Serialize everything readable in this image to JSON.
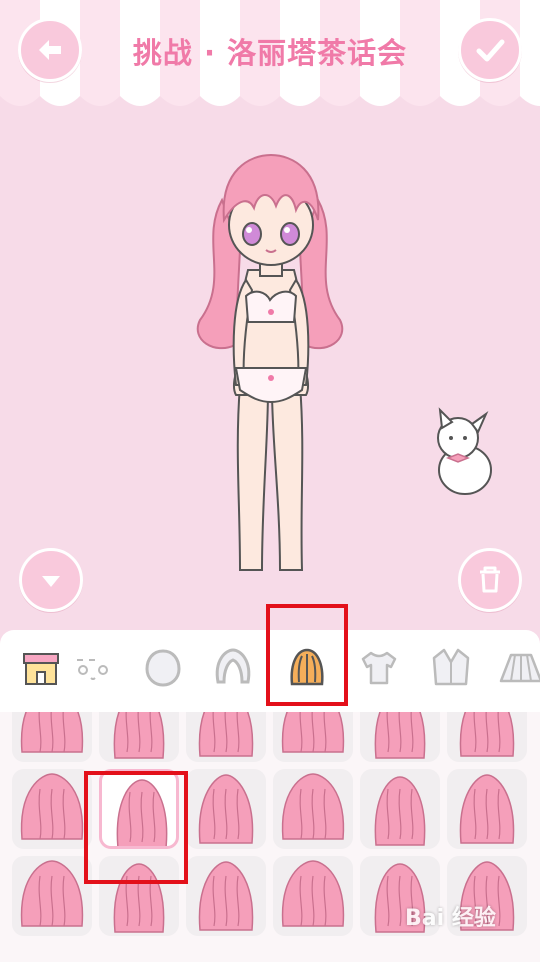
{
  "header": {
    "title": "挑战 · 洛丽塔茶话会"
  },
  "tabs": [
    {
      "id": "shop",
      "icon": "shop-icon"
    },
    {
      "id": "face",
      "icon": "face-icon"
    },
    {
      "id": "head",
      "icon": "head-icon"
    },
    {
      "id": "bangs",
      "icon": "bangs-icon"
    },
    {
      "id": "back-hair",
      "icon": "back-hair-icon",
      "selected": true
    },
    {
      "id": "top",
      "icon": "tshirt-icon"
    },
    {
      "id": "jacket",
      "icon": "jacket-icon"
    },
    {
      "id": "skirt",
      "icon": "skirt-icon"
    }
  ],
  "hair_grid": {
    "selected_index": 7,
    "item_count": 18
  },
  "watermark": {
    "text": "Bai 经验"
  },
  "colors": {
    "accent": "#f07aa8",
    "background": "#f7dbe8",
    "hair": "#f59fba",
    "highlight": "#e3101a"
  }
}
